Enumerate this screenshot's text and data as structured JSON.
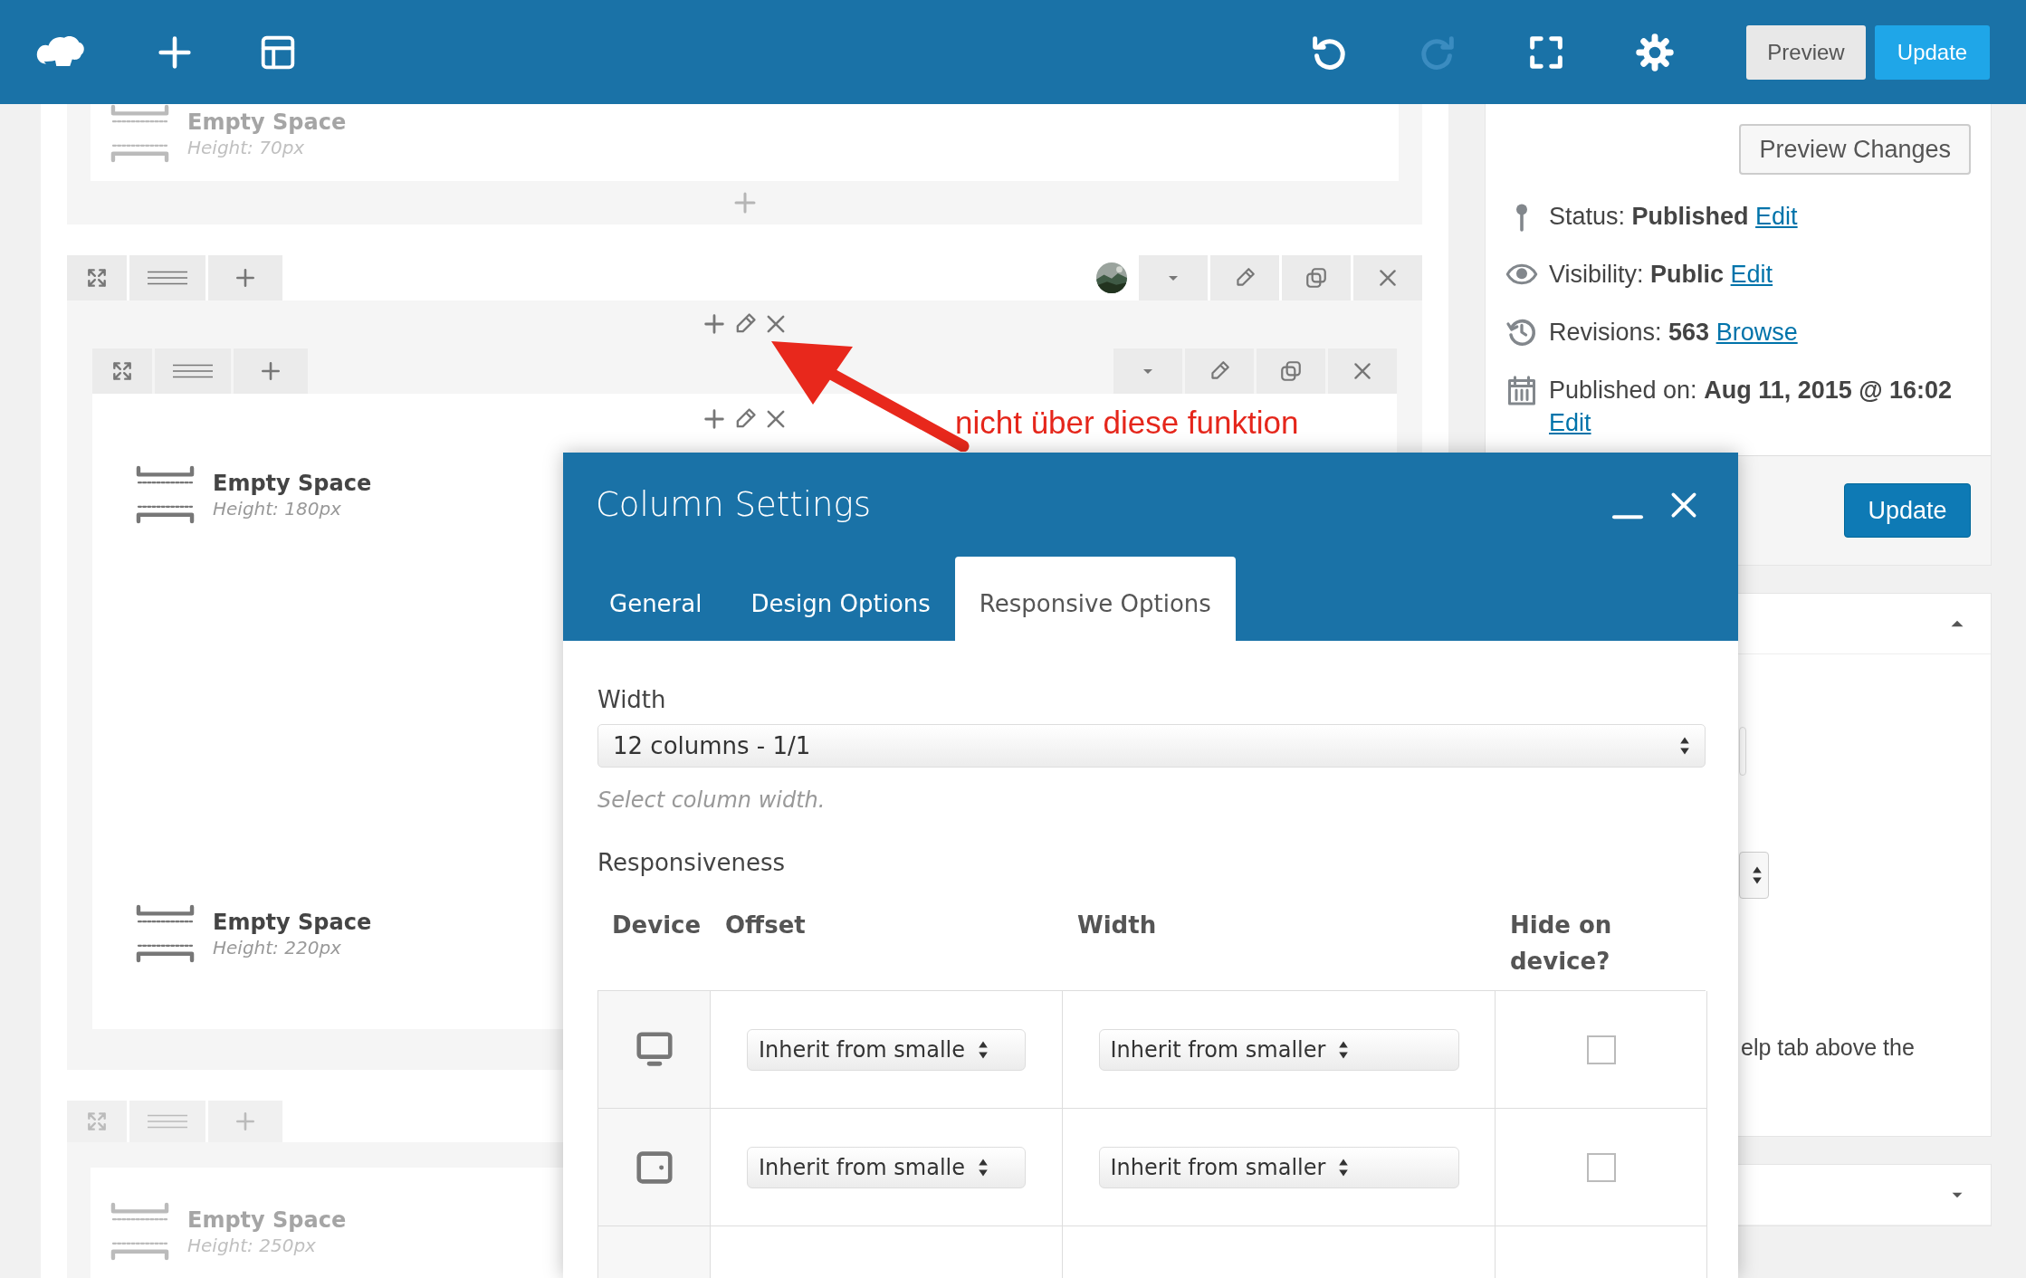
{
  "toolbar": {
    "redo": {
      "disabled": true
    },
    "buttons": [
      {
        "label": "Preview",
        "kind": "secondary"
      },
      {
        "label": "Update",
        "kind": "primary"
      }
    ]
  },
  "builder": {
    "rows": [
      {
        "dimmed": true,
        "handle_bar": false,
        "action_bar": false,
        "columns": [
          {
            "controls": false,
            "add_button": true,
            "elements": [
              {
                "title": "Empty Space",
                "detail": "Height: 70px"
              }
            ]
          }
        ]
      },
      {
        "dimmed": false,
        "handle_bar": true,
        "action_bar": true,
        "thumbnail": {
          "kind": "picture"
        },
        "columns": [
          {
            "controls": true,
            "inner_rows": [
              {
                "handle_bar": true,
                "action_bar": true,
                "columns": [
                  {
                    "controls": true,
                    "elements": [
                      {
                        "title": "Empty Space",
                        "detail": "Height: 180px"
                      },
                      {
                        "title": "Empty Space",
                        "detail": "Height: 220px"
                      }
                    ]
                  }
                ]
              }
            ]
          }
        ]
      },
      {
        "dimmed": true,
        "handle_bar": true,
        "action_bar": false,
        "columns": [
          {
            "controls": false,
            "add_button": false,
            "elements": [
              {
                "title": "Empty Space",
                "detail": "Height: 250px"
              }
            ]
          }
        ]
      }
    ]
  },
  "annotation": {
    "text": "nicht über diese funktion"
  },
  "sidebar": {
    "preview_button": "Preview Changes",
    "meta": [
      {
        "kind": "status",
        "label": "Status:",
        "value": "Published",
        "link": "Edit"
      },
      {
        "kind": "visibility",
        "label": "Visibility:",
        "value": "Public",
        "link": "Edit"
      },
      {
        "kind": "revisions",
        "label": "Revisions:",
        "value": "563",
        "link": "Browse"
      },
      {
        "kind": "published",
        "label": "Published on:",
        "value": "Aug 11, 2015 @ 16:02",
        "link": "Edit"
      }
    ],
    "update_button": "Update",
    "boxes": [
      {
        "expanded": true,
        "text": "elp tab above the"
      },
      {
        "expanded": false
      }
    ]
  },
  "modal": {
    "title": "Column Settings",
    "tabs": [
      {
        "label": "General",
        "selected": false
      },
      {
        "label": "Design Options",
        "selected": false
      },
      {
        "label": "Responsive Options",
        "selected": true
      }
    ],
    "width_label": "Width",
    "width_value": "12 columns - 1/1",
    "width_help": "Select column width.",
    "responsiveness_label": "Responsiveness",
    "table": {
      "columns": [
        "Device",
        "Offset",
        "Width",
        "Hide on device?"
      ],
      "rows": [
        {
          "kind": "desktop",
          "offset": "Inherit from smalle",
          "width": "Inherit from smaller",
          "checked": false
        },
        {
          "kind": "tablet",
          "offset": "Inherit from smalle",
          "width": "Inherit from smaller",
          "checked": false
        }
      ]
    }
  }
}
